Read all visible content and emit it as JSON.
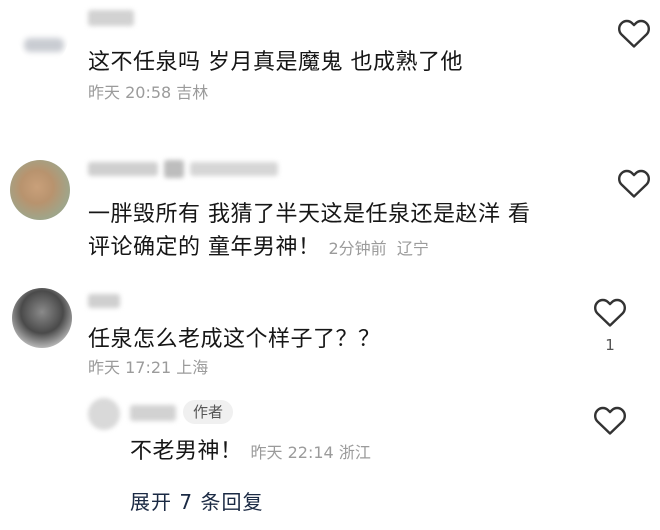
{
  "comments": [
    {
      "text": "这不任泉吗  岁月真是魔鬼    也成熟了他",
      "time": "昨天 20:58",
      "location": "吉林",
      "likes": ""
    },
    {
      "text_line1": "一胖毁所有 我猜了半天这是任泉还是赵洋 看",
      "text_line2": "评论确定的 童年男神！",
      "time": "2分钟前",
      "location": "辽宁",
      "likes": ""
    },
    {
      "text": "任泉怎么老成这个样子了？？",
      "time": "昨天 17:21",
      "location": "上海",
      "likes": "1"
    }
  ],
  "reply": {
    "author_tag": "作者",
    "text": "不老男神！",
    "time": "昨天 22:14",
    "location": "浙江"
  },
  "expand_replies": "展开 7 条回复",
  "colors": {
    "text": "#161616",
    "meta": "#9b9b9b",
    "heart_outline": "#333333",
    "expand": "#1b2a44"
  }
}
